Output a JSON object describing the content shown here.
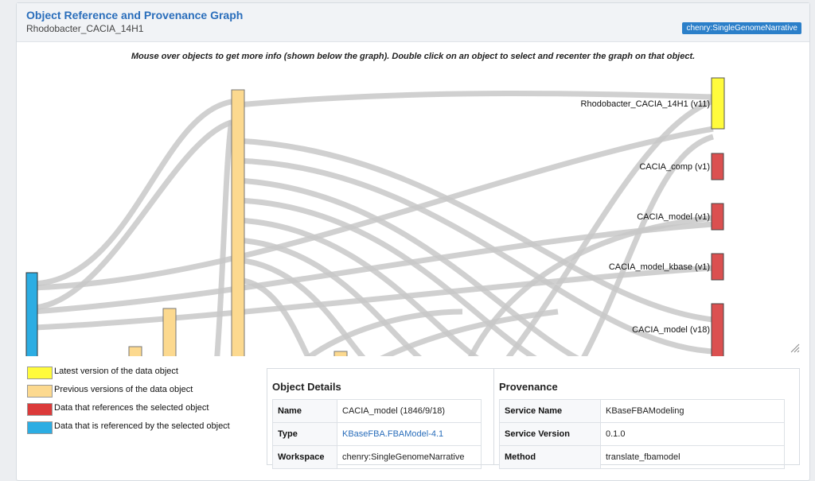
{
  "header": {
    "title": "Object Reference and Provenance Graph",
    "subtitle": "Rhodobacter_CACIA_14H1",
    "badge": "chenry:SingleGenomeNarrative"
  },
  "instructions": "Mouse over objects to get more info (shown below the graph). Double click on an object to select and recenter the graph on that object.",
  "graph": {
    "colors": {
      "latest": "#fffb3c",
      "previous": "#fcd98f",
      "references": "#db5050",
      "referenced_by": "#2cade3",
      "link": "#c8c8c8"
    },
    "nodes": [
      {
        "label": "Rhodobacter_CACIA_14H1 (v11)",
        "kind": "latest"
      },
      {
        "label": "CACIA_comp (v1)",
        "kind": "references"
      },
      {
        "label": "CACIA_model (v1)",
        "kind": "references"
      },
      {
        "label": "CACIA_model_kbase (v1)",
        "kind": "references"
      },
      {
        "label": "CACIA_model (v18)",
        "kind": "references"
      }
    ]
  },
  "legend": [
    {
      "label": "Latest version of the data object",
      "color": "#fffb3c"
    },
    {
      "label": "Previous versions of the data object",
      "color": "#fcd98f"
    },
    {
      "label": "Data that references the selected object",
      "color": "#db3a3a"
    },
    {
      "label": "Data that is referenced by the selected object",
      "color": "#2cade3"
    }
  ],
  "object_details": {
    "heading": "Object Details",
    "rows": [
      {
        "key": "Name",
        "value": "CACIA_model (1846/9/18)"
      },
      {
        "key": "Type",
        "value": "KBaseFBA.FBAModel-4.1"
      },
      {
        "key": "Workspace",
        "value": "chenry:SingleGenomeNarrative"
      }
    ]
  },
  "provenance": {
    "heading": "Provenance",
    "rows": [
      {
        "key": "Service Name",
        "value": "KBaseFBAModeling"
      },
      {
        "key": "Service Version",
        "value": "0.1.0"
      },
      {
        "key": "Method",
        "value": "translate_fbamodel"
      }
    ]
  }
}
